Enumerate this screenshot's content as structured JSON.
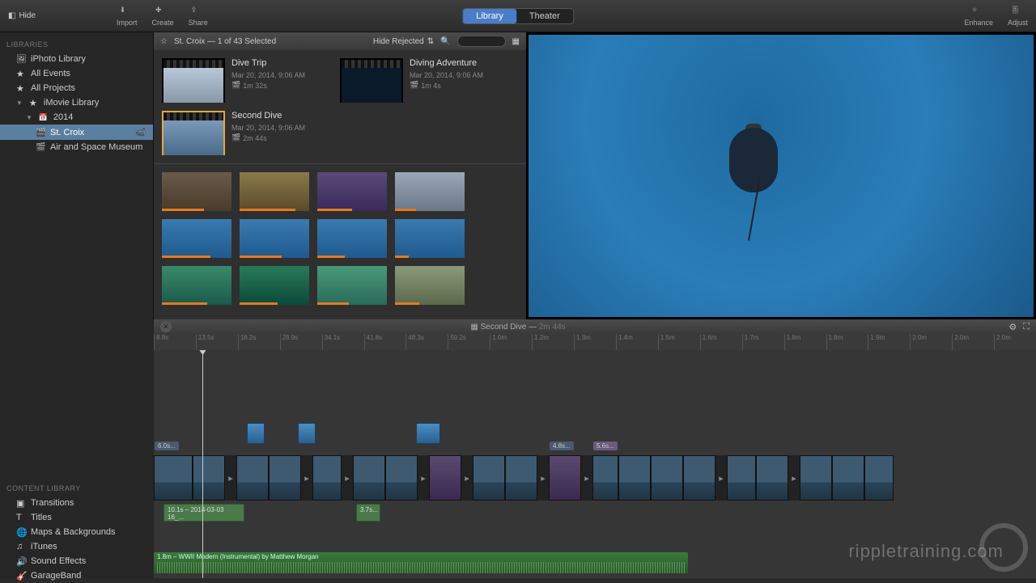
{
  "toolbar": {
    "hide": "Hide",
    "import": "Import",
    "create": "Create",
    "share": "Share",
    "enhance": "Enhance",
    "adjust": "Adjust",
    "tabs": {
      "library": "Library",
      "theater": "Theater"
    }
  },
  "sidebar": {
    "libraries_header": "LIBRARIES",
    "iphoto": "iPhoto Library",
    "all_events": "All Events",
    "all_projects": "All Projects",
    "imovie": "iMovie Library",
    "year": "2014",
    "stcroix": "St. Croix",
    "museum": "Air and Space Museum"
  },
  "browser": {
    "breadcrumb": "St. Croix — 1 of 43 Selected",
    "hide_rejected": "Hide Rejected",
    "projects": [
      {
        "title": "Dive Trip",
        "date": "Mar 20, 2014, 9:06 AM",
        "duration": "1m 32s"
      },
      {
        "title": "Diving Adventure",
        "date": "Mar 20, 2014, 9:06 AM",
        "duration": "1m 4s"
      },
      {
        "title": "Second Dive",
        "date": "Mar 20, 2014, 9:06 AM",
        "duration": "2m 44s"
      }
    ]
  },
  "timeline": {
    "title": "Second Dive",
    "duration": "2m 44s",
    "ruler": [
      "8.8s",
      "13.5s",
      "18.2s",
      "28.9s",
      "34.1s",
      "41.8s",
      "48.3s",
      "59.2s",
      "1.0m",
      "1.2m",
      "1.3m",
      "1.4m",
      "1.5m",
      "1.6m",
      "1.7m",
      "1.8m",
      "1.8m",
      "1.9m",
      "2.0m",
      "2.0m",
      "2.0m"
    ],
    "chip1": "6.0s...",
    "chip2": "4.8s...",
    "chip3": "5.6s...",
    "title_clip1": "10.1s – 2014-03-03 16_...",
    "title_clip2": "3.7s...",
    "music": "1.8m – WWII Modern (Instrumental) by Matthew Morgan"
  },
  "content_library": {
    "header": "CONTENT LIBRARY",
    "items": [
      "Transitions",
      "Titles",
      "Maps & Backgrounds",
      "iTunes",
      "Sound Effects",
      "GarageBand"
    ]
  },
  "watermark": "rippletraining.com"
}
